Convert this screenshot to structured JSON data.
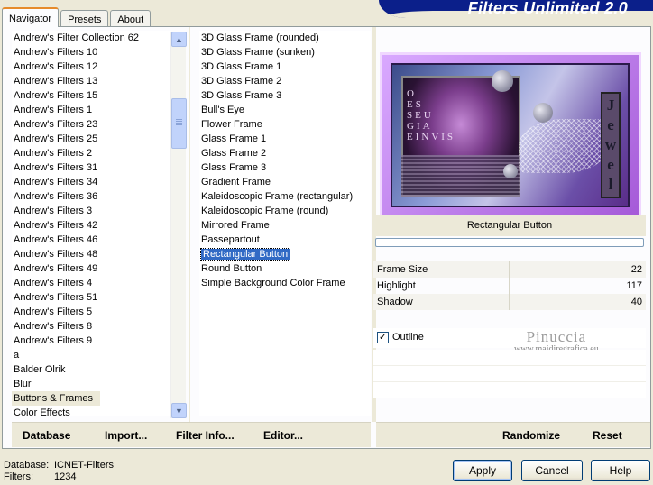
{
  "window": {
    "brand_title": "Filters Unlimited 2.0"
  },
  "tabs": [
    {
      "label": "Navigator",
      "active": true
    },
    {
      "label": "Presets",
      "active": false
    },
    {
      "label": "About",
      "active": false
    }
  ],
  "categories": {
    "items": [
      "Andrew's Filter Collection 62",
      "Andrew's Filters 10",
      "Andrew's Filters 12",
      "Andrew's Filters 13",
      "Andrew's Filters 15",
      "Andrew's Filters 1",
      "Andrew's Filters 23",
      "Andrew's Filters 25",
      "Andrew's Filters 2",
      "Andrew's Filters 31",
      "Andrew's Filters 34",
      "Andrew's Filters 36",
      "Andrew's Filters 3",
      "Andrew's Filters 42",
      "Andrew's Filters 46",
      "Andrew's Filters 48",
      "Andrew's Filters 49",
      "Andrew's Filters 4",
      "Andrew's Filters 51",
      "Andrew's Filters 5",
      "Andrew's Filters 8",
      "Andrew's Filters 9",
      "a",
      "Balder Olrik",
      "Blur",
      "Buttons & Frames",
      "Color Effects"
    ],
    "selected": "Buttons & Frames"
  },
  "filters": {
    "items": [
      {
        "label": "3D Glass Frame (rounded)",
        "group": false
      },
      {
        "label": "3D Glass Frame (sunken)",
        "group": false
      },
      {
        "label": "3D Glass Frame 1",
        "group": false
      },
      {
        "label": "3D Glass Frame 2",
        "group": false
      },
      {
        "label": "3D Glass Frame 3",
        "group": false
      },
      {
        "label": "Bull's Eye",
        "group": false
      },
      {
        "label": "Flower Frame",
        "group": true
      },
      {
        "label": "Glass Frame 1",
        "group": false
      },
      {
        "label": "Glass Frame 2",
        "group": false
      },
      {
        "label": "Glass Frame 3",
        "group": false
      },
      {
        "label": "Gradient Frame",
        "group": true
      },
      {
        "label": "Kaleidoscopic Frame (rectangular)",
        "group": false
      },
      {
        "label": "Kaleidoscopic Frame (round)",
        "group": false
      },
      {
        "label": "Mirrored Frame",
        "group": false
      },
      {
        "label": "Passepartout",
        "group": true
      },
      {
        "label": "Rectangular Button",
        "group": false
      },
      {
        "label": "Round Button",
        "group": false
      },
      {
        "label": "Simple Background Color Frame",
        "group": false
      }
    ],
    "selected": "Rectangular Button"
  },
  "left_toolbar": {
    "database": "Database",
    "import": "Import...",
    "filter_info": "Filter Info...",
    "editor": "Editor..."
  },
  "right_toolbar": {
    "randomize": "Randomize",
    "reset": "Reset"
  },
  "preview": {
    "text_lines": [
      "O",
      "ES",
      "SEU",
      "GIA",
      "EINVIS"
    ],
    "side_word": [
      "J",
      "e",
      "w",
      "e",
      "l"
    ]
  },
  "filter_panel": {
    "title": "Rectangular Button",
    "progress": 0,
    "params": [
      {
        "label": "Frame Size",
        "value": "22"
      },
      {
        "label": "Highlight",
        "value": "117"
      },
      {
        "label": "Shadow",
        "value": "40"
      }
    ],
    "outline": {
      "label": "Outline",
      "checked": true
    }
  },
  "watermark": {
    "name": "Pinuccia",
    "url": "www.maidiregrafica.eu"
  },
  "footer": {
    "database_label": "Database:",
    "database_value": "ICNET-Filters",
    "filters_label": "Filters:",
    "filters_value": "1234"
  },
  "buttons": {
    "apply": "Apply",
    "cancel": "Cancel",
    "help": "Help"
  }
}
